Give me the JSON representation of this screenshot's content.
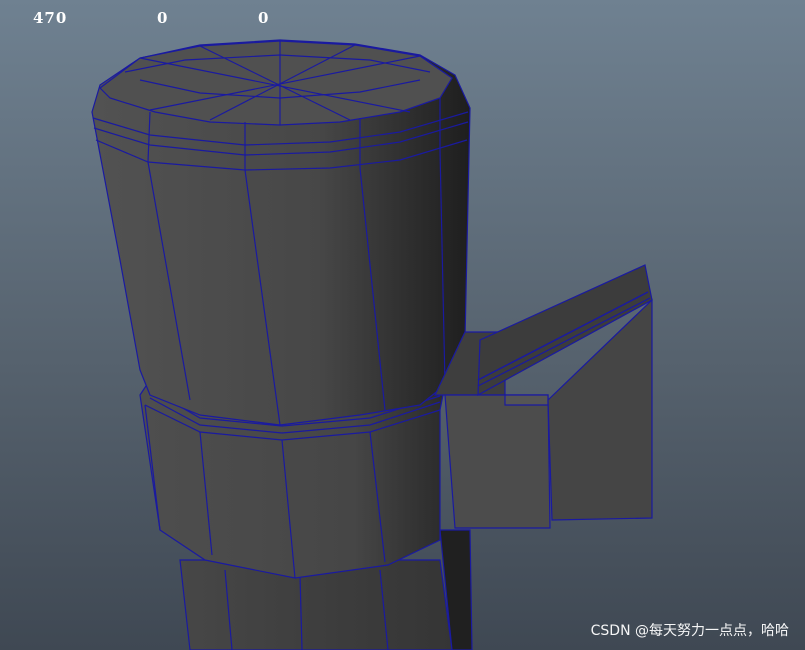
{
  "hud": {
    "values": [
      "470",
      "0",
      "0"
    ]
  },
  "colors": {
    "background_top": "#6f8191",
    "background_bottom": "#3f4853",
    "mesh_fill": "#4a4a4a",
    "wire": "#1a1aa0"
  },
  "watermark": "CSDN @每天努力一点点，哈哈"
}
